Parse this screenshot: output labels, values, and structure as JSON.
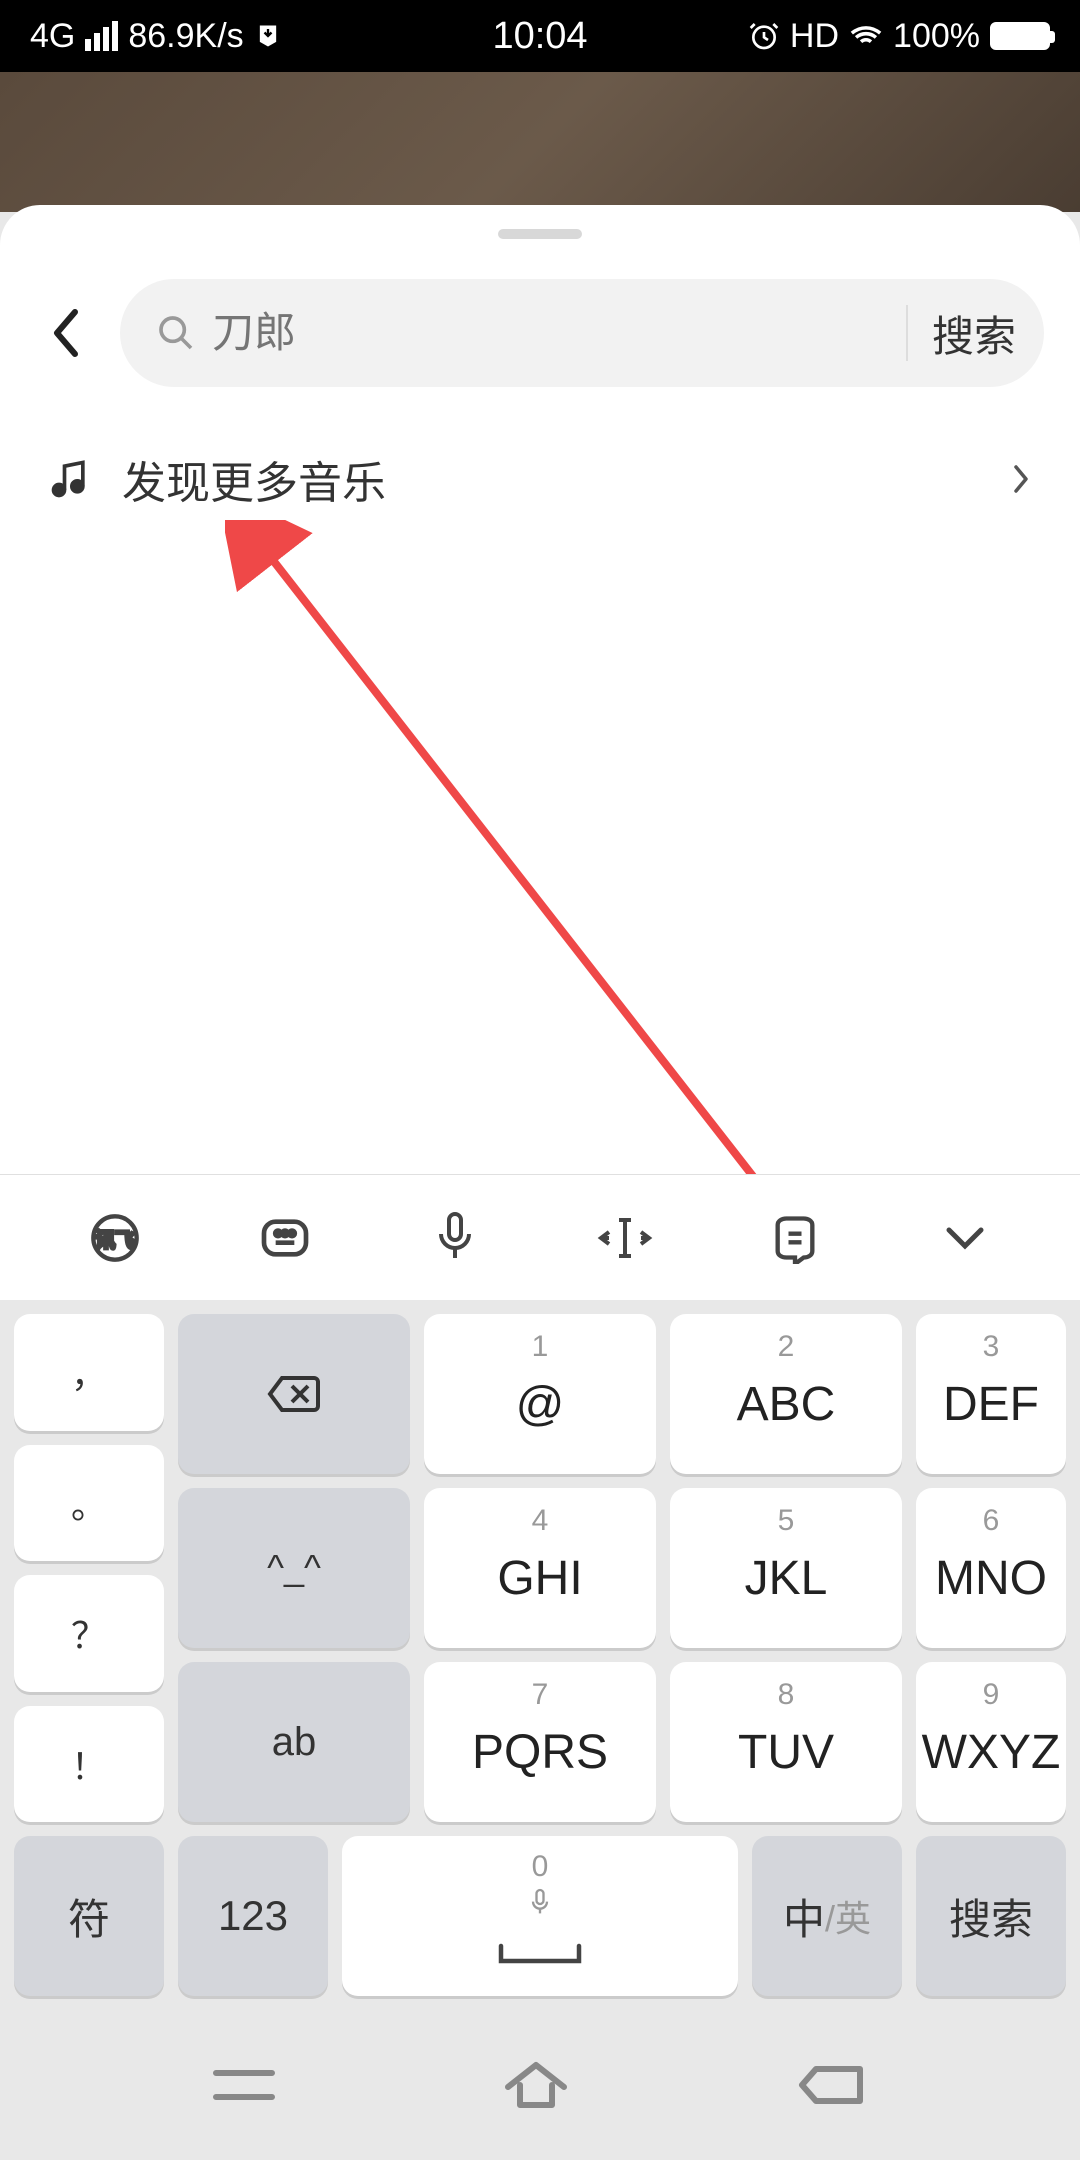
{
  "status": {
    "network": "4G",
    "speed": "86.9K/s",
    "time": "10:04",
    "hd": "HD",
    "battery_pct": "100%"
  },
  "search": {
    "placeholder": "刀郎",
    "button": "搜索"
  },
  "discover": {
    "label": "发现更多音乐"
  },
  "keyboard": {
    "keys": [
      {
        "num": "1",
        "letters": "@"
      },
      {
        "num": "2",
        "letters": "ABC"
      },
      {
        "num": "3",
        "letters": "DEF"
      },
      {
        "num": "4",
        "letters": "GHI"
      },
      {
        "num": "5",
        "letters": "JKL"
      },
      {
        "num": "6",
        "letters": "MNO"
      },
      {
        "num": "7",
        "letters": "PQRS"
      },
      {
        "num": "8",
        "letters": "TUV"
      },
      {
        "num": "9",
        "letters": "WXYZ"
      }
    ],
    "left_side": [
      "，",
      "。",
      "？",
      "！"
    ],
    "right_side": {
      "emoji": "^_^",
      "ab": "ab"
    },
    "bottom": {
      "symbol": "符",
      "num": "123",
      "space_num": "0",
      "lang_main": "中",
      "lang_sub": "/英",
      "search": "搜索"
    }
  }
}
